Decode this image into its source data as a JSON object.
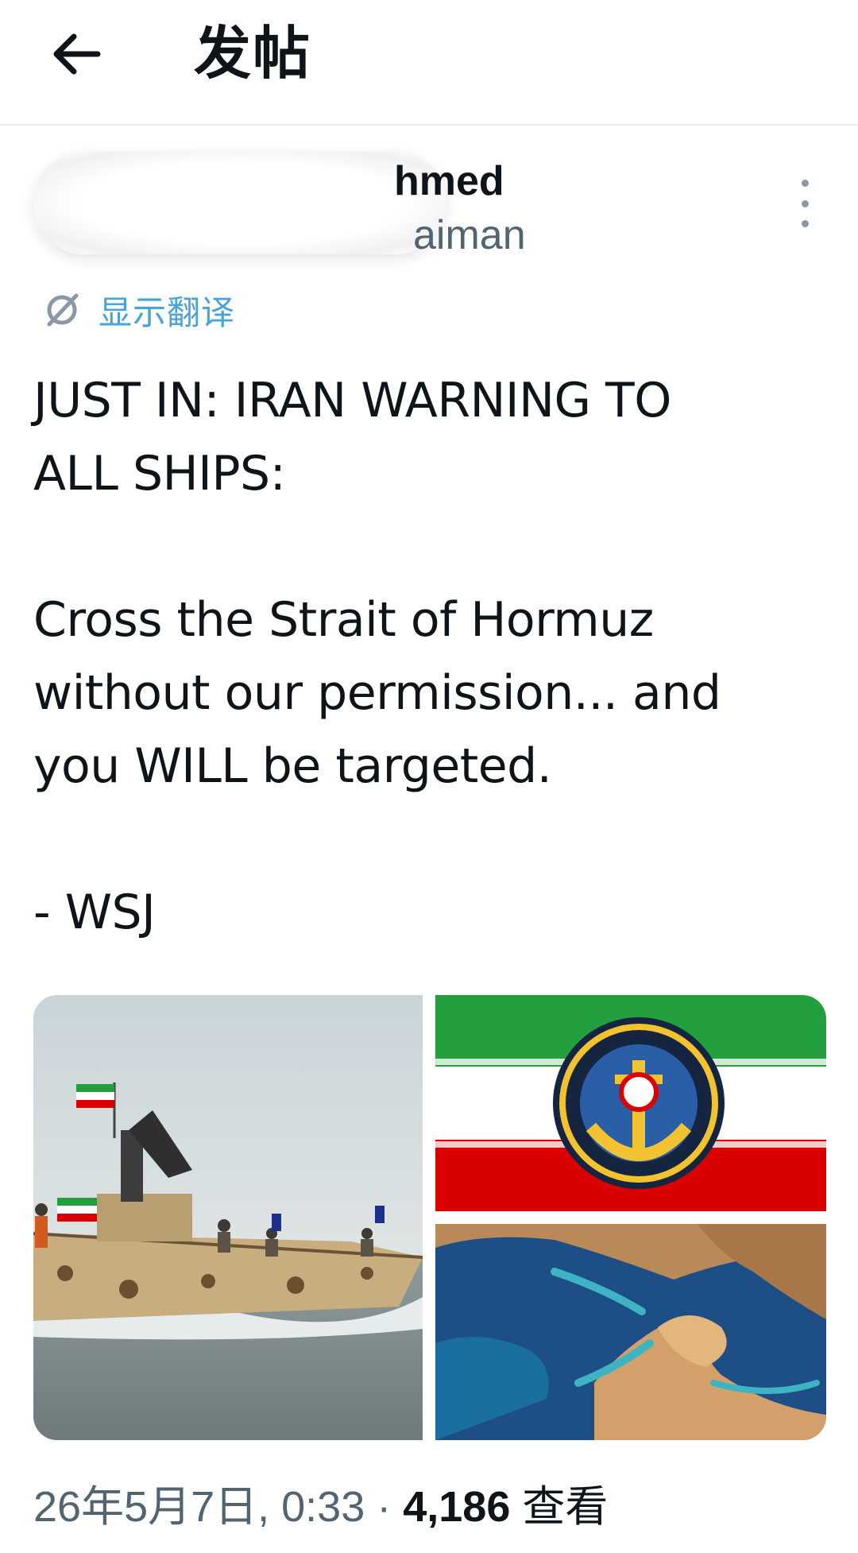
{
  "header": {
    "title": "发帖",
    "back_icon": "arrow-left-icon"
  },
  "author": {
    "display_name": "hmed",
    "handle": "aiman",
    "more_icon": "more-vertical-icon"
  },
  "translate": {
    "label": "显示翻译",
    "icon": "globe-slash-icon"
  },
  "tweet": {
    "line1": "JUST IN: IRAN WARNING TO\nALL SHIPS:",
    "line2": "Cross the Strait of Hormuz\nwithout our permission... and\nyou WILL be targeted.",
    "line3": "- WSJ"
  },
  "media": [
    {
      "name": "speedboat-photo"
    },
    {
      "name": "iran-navy-flag-emblem"
    },
    {
      "name": "strait-satellite-map"
    }
  ],
  "meta": {
    "date": "26年5月7日, 0:33",
    "separator": " · ",
    "views_count": "4,186",
    "views_label": "查看"
  },
  "colors": {
    "text": "#0f1419",
    "secondary": "#536471",
    "link": "#4aa3d6",
    "divider": "#e7e9ea"
  }
}
